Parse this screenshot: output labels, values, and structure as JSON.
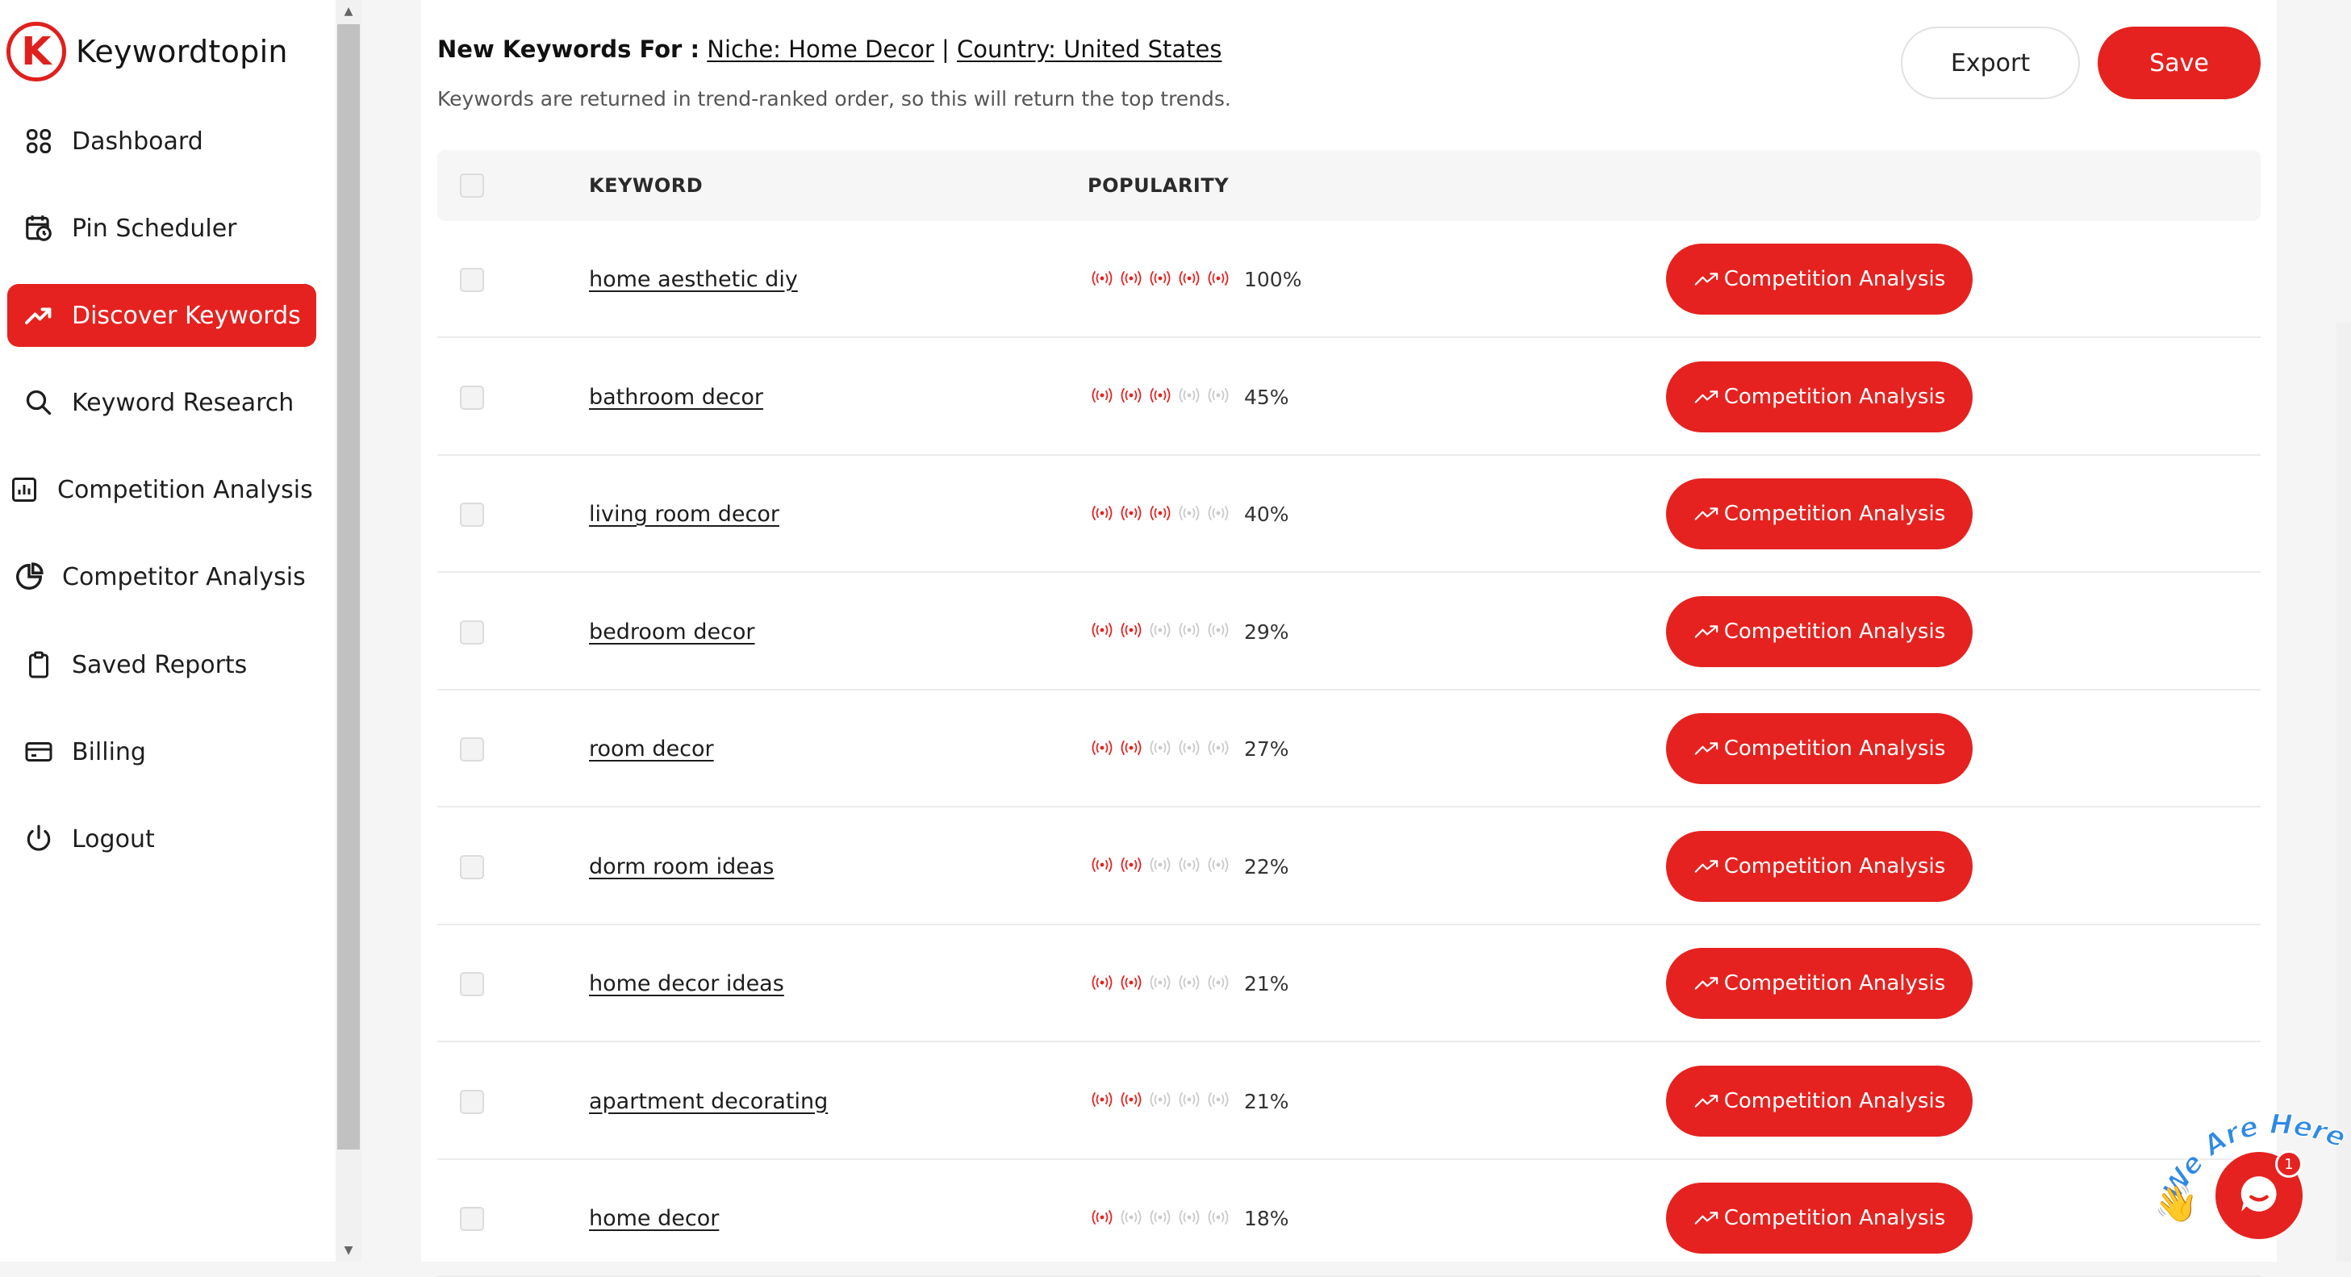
{
  "brand": {
    "logo_letter": "K",
    "name": "Keywordtopin",
    "accent": "#e5221f"
  },
  "sidebar": {
    "items": [
      {
        "label": "Dashboard",
        "icon": "grid-icon",
        "active": false
      },
      {
        "label": "Pin Scheduler",
        "icon": "calendar-clock-icon",
        "active": false
      },
      {
        "label": "Discover Keywords",
        "icon": "trending-up-icon",
        "active": true
      },
      {
        "label": "Keyword Research",
        "icon": "search-icon",
        "active": false
      },
      {
        "label": "Competition Analysis",
        "icon": "bar-chart-icon",
        "active": false
      },
      {
        "label": "Competitor Analysis",
        "icon": "pie-chart-icon",
        "active": false
      },
      {
        "label": "Saved Reports",
        "icon": "clipboard-icon",
        "active": false
      },
      {
        "label": "Billing",
        "icon": "credit-card-icon",
        "active": false
      },
      {
        "label": "Logout",
        "icon": "power-icon",
        "active": false
      }
    ]
  },
  "header": {
    "lead": "New Keywords For :",
    "niche_link": "Niche: Home Decor",
    "separator": "|",
    "country_link": "Country: United States",
    "subtitle": "Keywords are returned in trend-ranked order, so this will return the top trends.",
    "export_label": "Export",
    "save_label": "Save"
  },
  "table": {
    "columns": {
      "keyword": "KEYWORD",
      "popularity": "POPULARITY"
    },
    "action_label": "Competition Analysis",
    "rows": [
      {
        "keyword": "home aesthetic diy",
        "popularity": "100%",
        "level": 5
      },
      {
        "keyword": "bathroom decor",
        "popularity": "45%",
        "level": 3
      },
      {
        "keyword": "living room decor",
        "popularity": "40%",
        "level": 3
      },
      {
        "keyword": "bedroom decor",
        "popularity": "29%",
        "level": 2
      },
      {
        "keyword": "room decor",
        "popularity": "27%",
        "level": 2
      },
      {
        "keyword": "dorm room ideas",
        "popularity": "22%",
        "level": 2
      },
      {
        "keyword": "home decor ideas",
        "popularity": "21%",
        "level": 2
      },
      {
        "keyword": "apartment decorating",
        "popularity": "21%",
        "level": 2
      },
      {
        "keyword": "home decor",
        "popularity": "18%",
        "level": 1
      }
    ]
  },
  "chat": {
    "badge": "1",
    "tagline": "We Are Here!",
    "wave_emoji": "👋"
  },
  "colors": {
    "signal_on": "#e5221f",
    "signal_off": "#c9c9c9"
  }
}
